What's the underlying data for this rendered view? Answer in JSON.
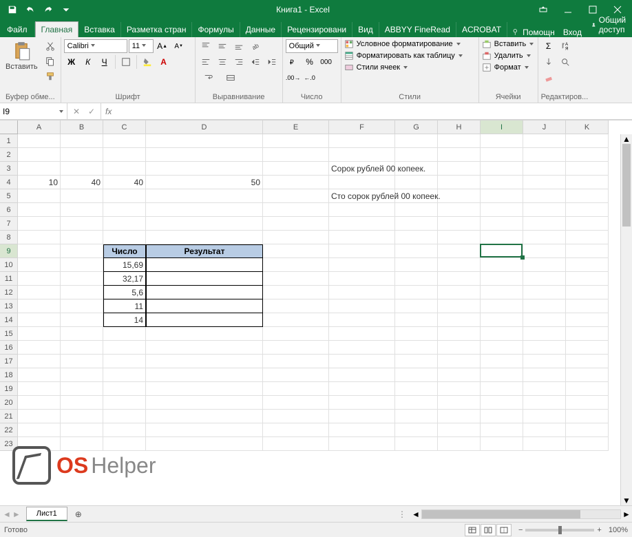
{
  "app": {
    "title": "Книга1 - Excel"
  },
  "tabs": {
    "file": "Файл",
    "list": [
      "Главная",
      "Вставка",
      "Разметка стран",
      "Формулы",
      "Данные",
      "Рецензировани",
      "Вид",
      "ABBYY FineRead",
      "ACROBAT"
    ],
    "active_index": 0,
    "help": "Помощн",
    "login": "Вход",
    "share": "Общий доступ"
  },
  "ribbon": {
    "clipboard": {
      "paste": "Вставить",
      "group": "Буфер обме..."
    },
    "font": {
      "name": "Calibri",
      "size": "11",
      "group": "Шрифт",
      "bold": "Ж",
      "italic": "К",
      "underline": "Ч"
    },
    "align": {
      "group": "Выравнивание"
    },
    "number": {
      "format": "Общий",
      "group": "Число"
    },
    "styles": {
      "cond": "Условное форматирование",
      "table": "Форматировать как таблицу",
      "cell": "Стили ячеек",
      "group": "Стили"
    },
    "cells": {
      "insert": "Вставить",
      "delete": "Удалить",
      "format": "Формат",
      "group": "Ячейки"
    },
    "editing": {
      "group": "Редактиров..."
    }
  },
  "formula": {
    "namebox": "I9",
    "value": ""
  },
  "columns": [
    "A",
    "B",
    "C",
    "D",
    "E",
    "F",
    "G",
    "H",
    "I",
    "J",
    "K"
  ],
  "rows": [
    "1",
    "2",
    "3",
    "4",
    "5",
    "6",
    "7",
    "8",
    "9",
    "10",
    "11",
    "12",
    "13",
    "14",
    "15",
    "16",
    "17",
    "18",
    "19",
    "20",
    "21",
    "22",
    "23"
  ],
  "cells": {
    "A4": "10",
    "B4": "40",
    "C4": "40",
    "D4": "50",
    "F3": "Сорок рублей  00 копеек.",
    "F5": "Сто сорок рублей  00 копеек.",
    "C9": "Число",
    "D9": "Результат",
    "C10": "15,69",
    "C11": "32,17",
    "C12": "5,6",
    "C13": "11",
    "C14": "14"
  },
  "selection": {
    "cell": "I9",
    "col": "I",
    "row": "9"
  },
  "sheets": {
    "active": "Лист1"
  },
  "status": {
    "ready": "Готово",
    "zoom": "100%"
  },
  "logo": {
    "p1": "OS",
    "p2": "Helper"
  },
  "chart_data": {
    "type": "table",
    "title": "Число / Результат",
    "columns": [
      "Число",
      "Результат"
    ],
    "rows": [
      {
        "Число": "15,69",
        "Результат": ""
      },
      {
        "Число": "32,17",
        "Результат": ""
      },
      {
        "Число": "5,6",
        "Результат": ""
      },
      {
        "Число": "11",
        "Результат": ""
      },
      {
        "Число": "14",
        "Результат": ""
      }
    ],
    "extra_row_values": {
      "A4": 10,
      "B4": 40,
      "C4": 40,
      "D4": 50
    },
    "text_cells": {
      "F3": "Сорок рублей  00 копеек.",
      "F5": "Сто сорок рублей  00 копеек."
    }
  }
}
